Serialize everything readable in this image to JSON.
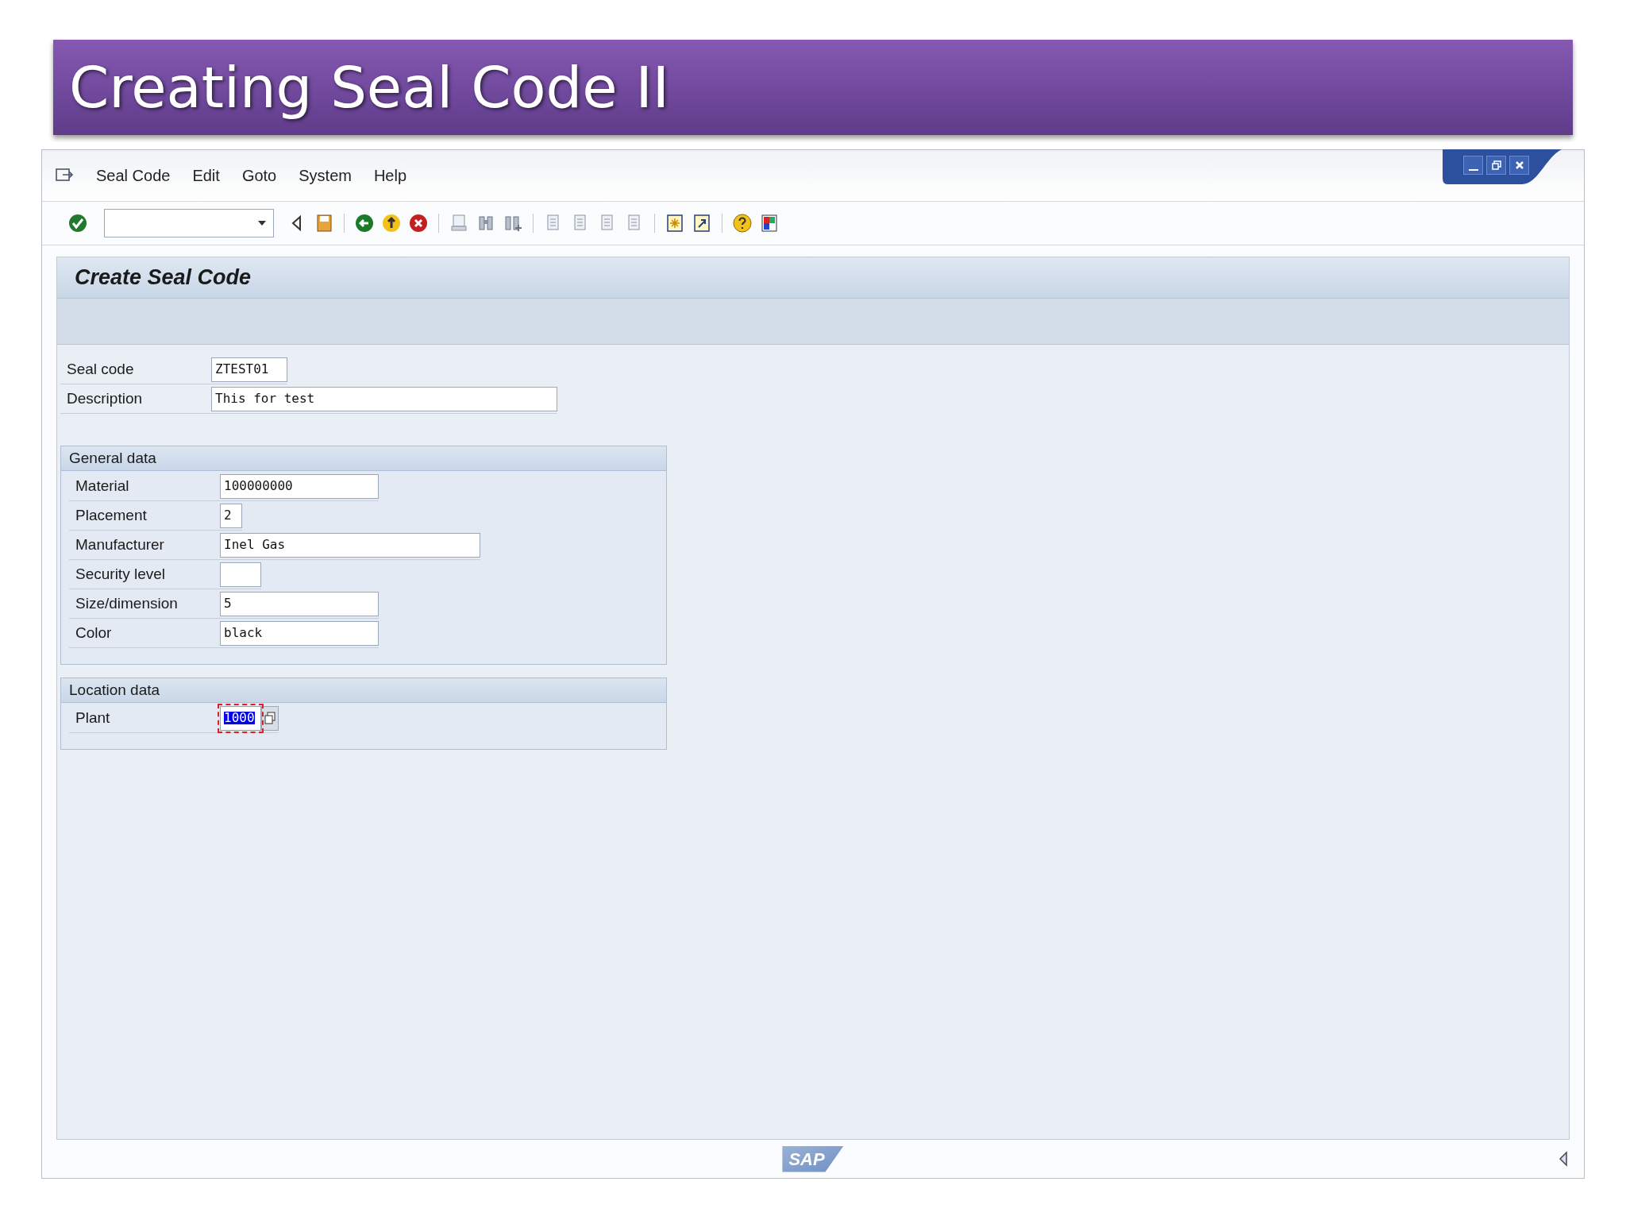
{
  "slide": {
    "title": "Creating Seal Code II"
  },
  "menu": [
    {
      "label": "Seal Code"
    },
    {
      "label": "Edit"
    },
    {
      "label": "Goto"
    },
    {
      "label": "System"
    },
    {
      "label": "Help"
    }
  ],
  "screen": {
    "title": "Create Seal Code"
  },
  "header_fields": [
    {
      "label": "Seal code",
      "value": "ZTEST01",
      "focused": false
    },
    {
      "label": "Description",
      "value": "This for test",
      "focused": false
    }
  ],
  "groups": [
    {
      "title": "General data",
      "fields": [
        {
          "label": "Material",
          "value": "100000000",
          "focused": false
        },
        {
          "label": "Placement",
          "value": "2",
          "focused": false
        },
        {
          "label": "Manufacturer",
          "value": "Inel Gas",
          "focused": false
        },
        {
          "label": "Security level",
          "focused": false
        },
        {
          "label": "Size/dimension",
          "value": "5",
          "focused": false
        },
        {
          "label": "Color",
          "value": "black",
          "focused": false
        }
      ]
    },
    {
      "title": "Location data",
      "fields": [
        {
          "label": "Plant",
          "value": "1000",
          "focused": true,
          "search_help": true
        }
      ]
    }
  ],
  "footer": {
    "logo": "SAP"
  }
}
